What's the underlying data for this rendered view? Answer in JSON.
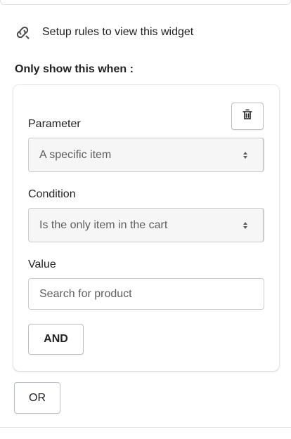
{
  "header": {
    "icon": "link-chain-icon",
    "title": "Setup rules to view this widget"
  },
  "rules": {
    "section_label": "Only show this when :",
    "delete_icon": "trash-icon",
    "parameter": {
      "label": "Parameter",
      "value": "A specific item"
    },
    "condition": {
      "label": "Condition",
      "value": "Is the only item in the cart"
    },
    "value_field": {
      "label": "Value",
      "placeholder": "Search for product"
    },
    "and_label": "AND"
  },
  "or_label": "OR"
}
